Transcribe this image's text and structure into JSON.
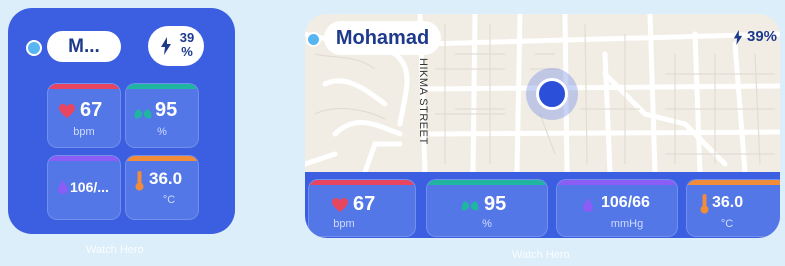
{
  "small_widget": {
    "name": "M...",
    "battery_pct": "39\n%",
    "battery_pct_line1": "39",
    "battery_pct_line2": "%",
    "tiles": {
      "heart": {
        "value": "67",
        "unit": "bpm",
        "color": "#e84560",
        "icon": "heart-icon"
      },
      "oxygen": {
        "value": "95",
        "unit": "%",
        "color": "#1fb5a0",
        "icon": "lungs-icon"
      },
      "pressure": {
        "value": "106/...",
        "unit": "",
        "color": "#8b5cf6",
        "icon": "blood-drop-icon"
      },
      "temperature": {
        "value": "36.0",
        "unit": "°C",
        "color": "#f08c3a",
        "icon": "thermometer-icon"
      }
    },
    "caption": "Watch Hero"
  },
  "wide_widget": {
    "name": "Mohamad",
    "battery_pct": "39%",
    "map": {
      "street_label": "HIKMA STREET"
    },
    "tiles": {
      "heart": {
        "value": "67",
        "unit": "bpm"
      },
      "oxygen": {
        "value": "95",
        "unit": "%"
      },
      "pressure": {
        "value": "106/66",
        "unit": "mmHg"
      },
      "temperature": {
        "value": "36.0",
        "unit": "°C"
      }
    },
    "caption": "Watch Hero"
  },
  "colors": {
    "widget_bg": "#3b5fe0",
    "tile_bg": "#5477e7",
    "heart": "#e84560",
    "oxygen": "#1fb5a0",
    "pressure": "#8b5cf6",
    "temperature": "#f08c3a",
    "accent_text": "#1e3a8a"
  }
}
